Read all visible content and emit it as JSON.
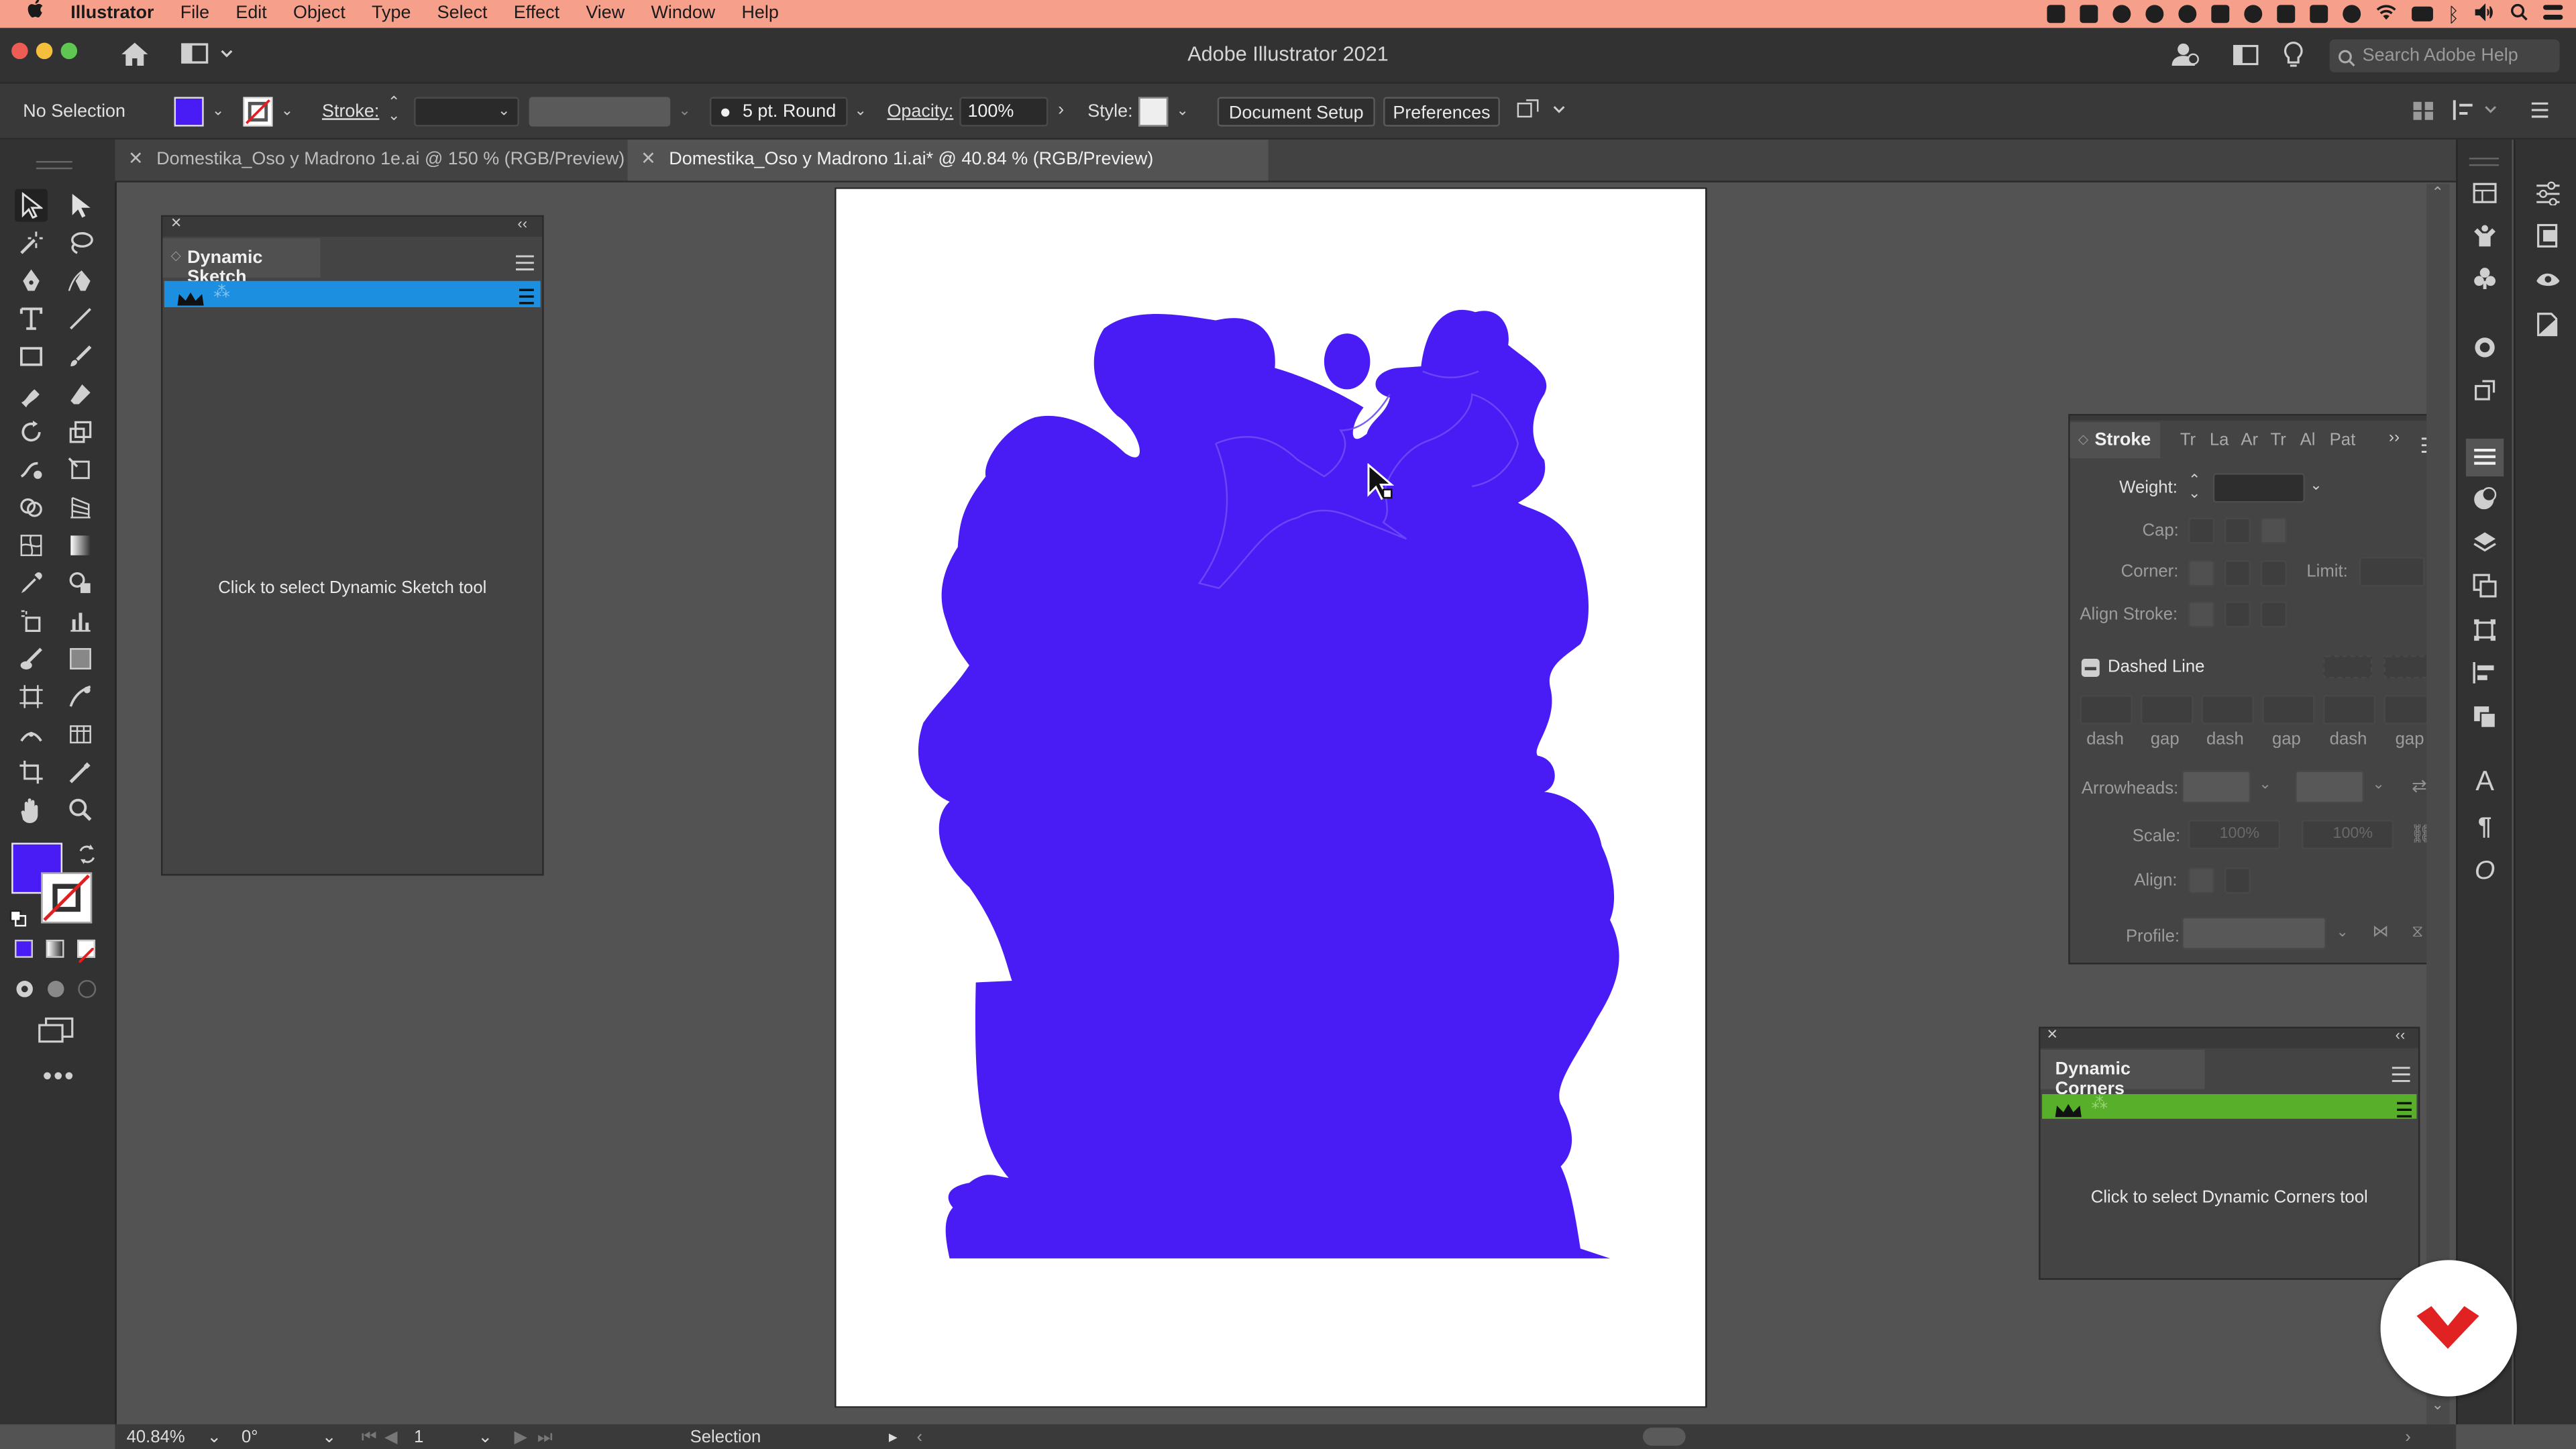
{
  "menubar": {
    "apple": "",
    "app_name": "Illustrator",
    "items": [
      "File",
      "Edit",
      "Object",
      "Type",
      "Select",
      "Effect",
      "View",
      "Window",
      "Help"
    ]
  },
  "app": {
    "title": "Adobe Illustrator 2021",
    "search_placeholder": "Search Adobe Help"
  },
  "control": {
    "selection": "No Selection",
    "stroke_label": "Stroke:",
    "brush": "5 pt. Round",
    "opacity_label": "Opacity:",
    "opacity_value": "100%",
    "style_label": "Style:",
    "document_setup": "Document Setup",
    "preferences": "Preferences",
    "fill_color": "#4a1cf5"
  },
  "tabs": [
    {
      "label": "Domestika_Oso y Madrono 1e.ai @ 150 % (RGB/Preview)",
      "active": false
    },
    {
      "label": "Domestika_Oso y Madrono 1i.ai* @ 40.84 % (RGB/Preview)",
      "active": true
    }
  ],
  "dynamic_sketch": {
    "title": "Dynamic Sketch",
    "message": "Click to select Dynamic Sketch tool",
    "bar_color": "#1c8fe0"
  },
  "stroke_panel": {
    "title": "Stroke",
    "other_tabs": [
      "Tr",
      "La",
      "Ar",
      "Tr",
      "Al",
      "Pat"
    ],
    "weight_label": "Weight:",
    "cap_label": "Cap:",
    "corner_label": "Corner:",
    "limit_label": "Limit:",
    "align_stroke_label": "Align Stroke:",
    "dashed_line_label": "Dashed Line",
    "dash_labels": [
      "dash",
      "gap",
      "dash",
      "gap",
      "dash",
      "gap"
    ],
    "arrowheads_label": "Arrowheads:",
    "scale_label": "Scale:",
    "scale_value": "100%",
    "align_label": "Align:",
    "profile_label": "Profile:"
  },
  "dynamic_corners": {
    "title": "Dynamic Corners",
    "message": "Click to select Dynamic Corners tool",
    "bar_color": "#58b02a"
  },
  "artwork": {
    "fill": "#4a1cf5"
  },
  "status": {
    "zoom": "40.84%",
    "rotation": "0°",
    "artboard": "1",
    "tool": "Selection"
  }
}
